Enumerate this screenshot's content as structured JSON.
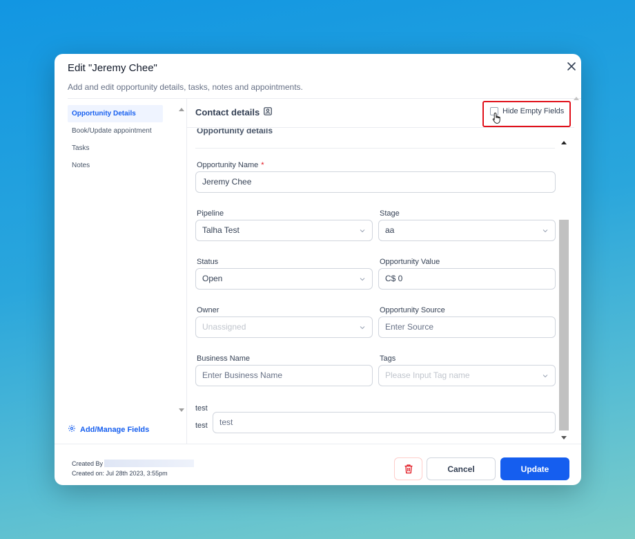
{
  "modal": {
    "title": "Edit \"Jeremy Chee\"",
    "subtitle": "Add and edit opportunity details, tasks, notes and appointments."
  },
  "sidebar": {
    "items": [
      {
        "label": "Opportunity Details",
        "active": true
      },
      {
        "label": "Book/Update appointment",
        "active": false
      },
      {
        "label": "Tasks",
        "active": false
      },
      {
        "label": "Notes",
        "active": false
      }
    ],
    "add_manage_label": "Add/Manage Fields"
  },
  "header": {
    "contact_title": "Contact details",
    "hide_empty_label": "Hide Empty Fields",
    "hide_empty_checked": false
  },
  "form": {
    "section_title": "Opportunity details",
    "opportunity_name": {
      "label": "Opportunity Name",
      "required_mark": "*",
      "value": "Jeremy Chee"
    },
    "pipeline": {
      "label": "Pipeline",
      "value": "Talha Test"
    },
    "stage": {
      "label": "Stage",
      "value": "aa"
    },
    "status": {
      "label": "Status",
      "value": "Open"
    },
    "opportunity_value": {
      "label": "Opportunity Value",
      "value": "C$ 0"
    },
    "owner": {
      "label": "Owner",
      "placeholder": "Unassigned"
    },
    "opportunity_source": {
      "label": "Opportunity Source",
      "placeholder": "Enter Source"
    },
    "business_name": {
      "label": "Business Name",
      "placeholder": "Enter Business Name"
    },
    "tags": {
      "label": "Tags",
      "placeholder": "Please Input Tag name"
    },
    "test": {
      "label": "test",
      "inline_label": "test",
      "value": "test"
    }
  },
  "footer": {
    "created_by_label": "Created By",
    "created_on": "Created on: Jul 28th 2023, 3:55pm",
    "cancel_label": "Cancel",
    "update_label": "Update"
  },
  "colors": {
    "accent": "#155eef",
    "highlight_border": "#e0101a",
    "delete_icon": "#e0101a"
  }
}
